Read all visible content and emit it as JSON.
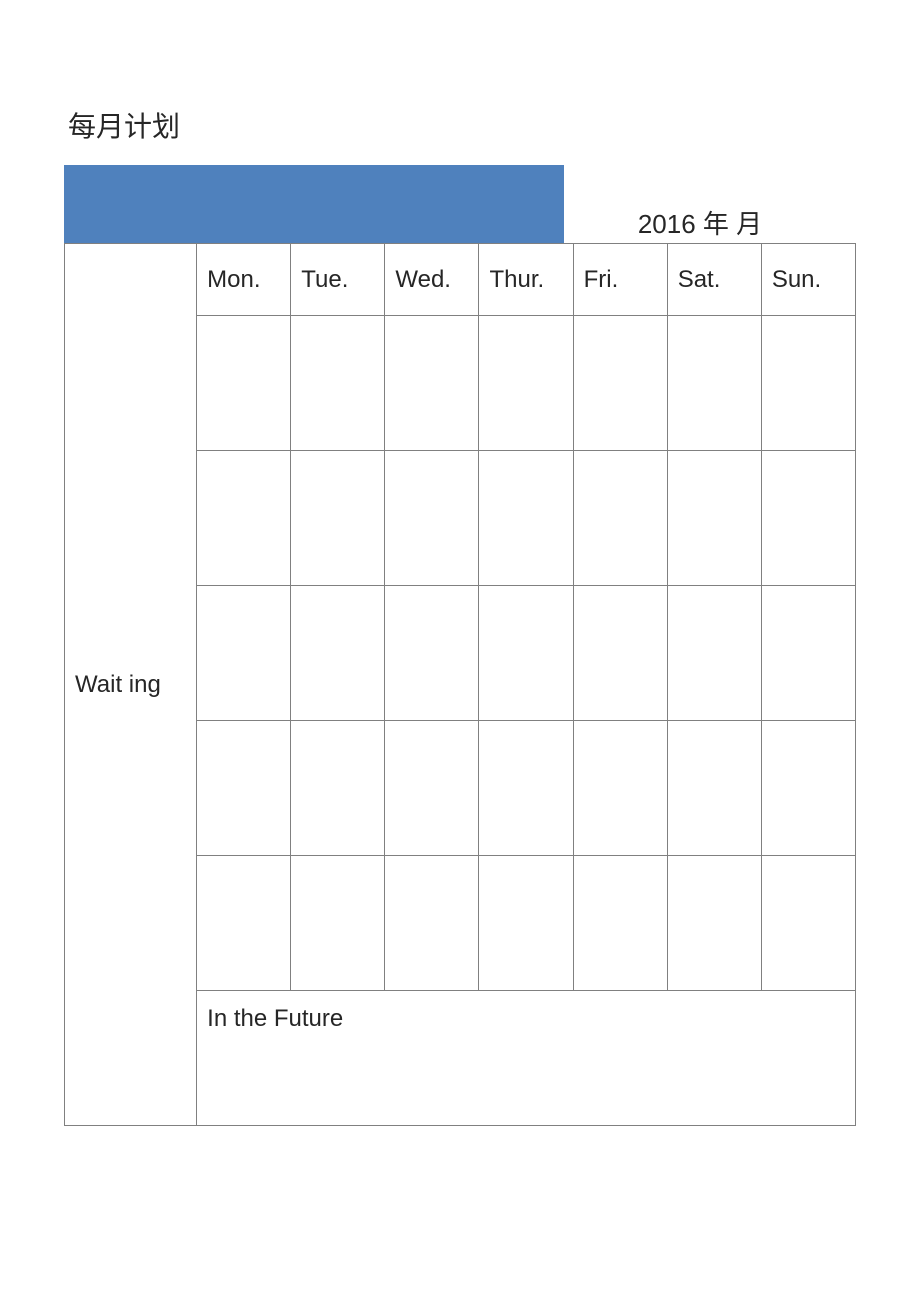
{
  "title": "每月计划",
  "date_label": "2016 年 月",
  "columns": {
    "waiting": "Wait ing",
    "mon": "Mon.",
    "tue": "Tue.",
    "wed": "Wed.",
    "thur": "Thur.",
    "fri": "Fri.",
    "sat": "Sat.",
    "sun": "Sun."
  },
  "future_label": "In the Future"
}
